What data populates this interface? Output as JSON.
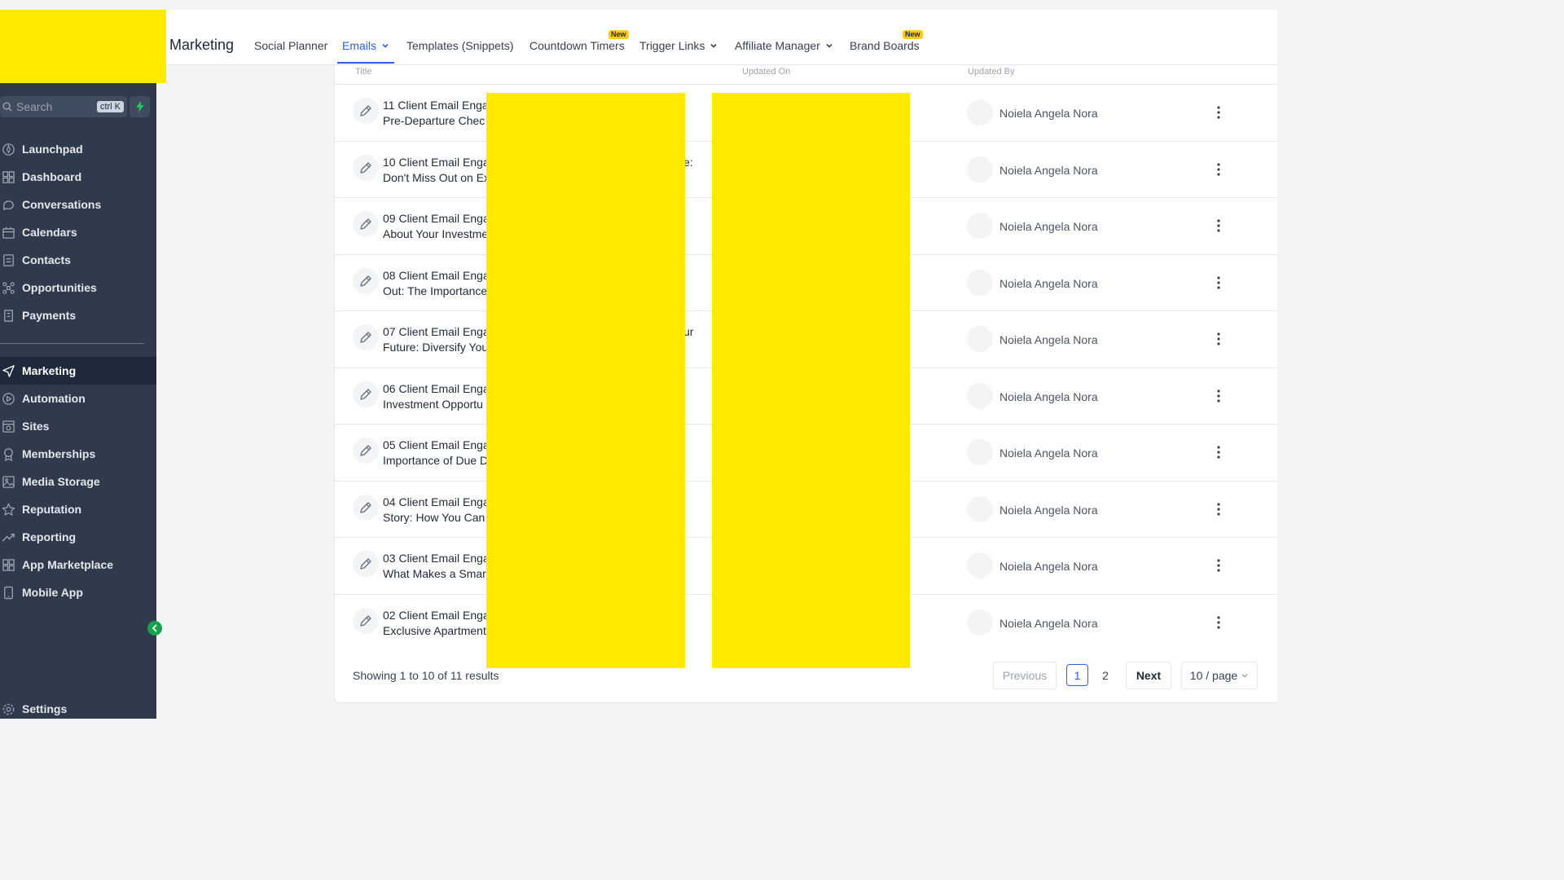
{
  "header": {
    "title": "Marketing",
    "tabs": [
      {
        "label": "Social Planner"
      },
      {
        "label": "Emails"
      },
      {
        "label": "Templates (Snippets)"
      },
      {
        "label": "Countdown Timers",
        "badge": "New"
      },
      {
        "label": "Trigger Links"
      },
      {
        "label": "Affiliate Manager"
      },
      {
        "label": "Brand Boards",
        "badge": "New"
      }
    ]
  },
  "sidebar": {
    "search_placeholder": "Search",
    "search_shortcut": "ctrl K",
    "items": [
      {
        "label": "Launchpad"
      },
      {
        "label": "Dashboard"
      },
      {
        "label": "Conversations"
      },
      {
        "label": "Calendars"
      },
      {
        "label": "Contacts"
      },
      {
        "label": "Opportunities"
      },
      {
        "label": "Payments"
      },
      {
        "label": "Marketing"
      },
      {
        "label": "Automation"
      },
      {
        "label": "Sites"
      },
      {
        "label": "Memberships"
      },
      {
        "label": "Media Storage"
      },
      {
        "label": "Reputation"
      },
      {
        "label": "Reporting"
      },
      {
        "label": "App Marketplace"
      },
      {
        "label": "Mobile App"
      }
    ],
    "settings_label": "Settings"
  },
  "table": {
    "columns": {
      "title": "Title",
      "updated_on": "Updated On",
      "updated_by": "Updated By"
    },
    "rows": [
      {
        "line1": "11 Client Email Enga",
        "line2": "Pre-Departure Chec",
        "overflow": "",
        "updated_by": "Noiela Angela Nora"
      },
      {
        "line1": "10 Client Email Enga",
        "line2": "Don't Miss Out on Ex",
        "overflow": "e:",
        "updated_by": "Noiela Angela Nora"
      },
      {
        "line1": "09 Client Email Enga",
        "line2": "About Your Investme",
        "overflow": "",
        "updated_by": "Noiela Angela Nora"
      },
      {
        "line1": "08 Client Email Enga",
        "line2": "Out: The Importance",
        "overflow": "",
        "updated_by": "Noiela Angela Nora"
      },
      {
        "line1": "07 Client Email Enga",
        "line2": "Future: Diversify You",
        "overflow": "ur",
        "updated_by": "Noiela Angela Nora"
      },
      {
        "line1": "06 Client Email Enga",
        "line2": "Investment Opportu",
        "overflow": "",
        "updated_by": "Noiela Angela Nora"
      },
      {
        "line1": "05 Client Email Enga",
        "line2": "Importance of Due D",
        "overflow": "",
        "updated_by": "Noiela Angela Nora"
      },
      {
        "line1": "04 Client Email Enga",
        "line2": "Story: How You Can",
        "overflow": "",
        "updated_by": "Noiela Angela Nora"
      },
      {
        "line1": "03 Client Email Enga",
        "line2": "What Makes a Smar",
        "overflow": "",
        "updated_by": "Noiela Angela Nora"
      },
      {
        "line1": "02 Client Email Enga",
        "line2": "Exclusive Apartment",
        "overflow": "",
        "updated_by": "Noiela Angela Nora"
      }
    ]
  },
  "pagination": {
    "summary": "Showing 1 to 10 of 11 results",
    "previous": "Previous",
    "page1": "1",
    "page2": "2",
    "next": "Next",
    "page_size": "10 / page"
  },
  "colors": {
    "accent": "#2563eb",
    "sidebar": "#2f3b4d",
    "redaction": "#ffea00",
    "badge": "#facc15"
  }
}
